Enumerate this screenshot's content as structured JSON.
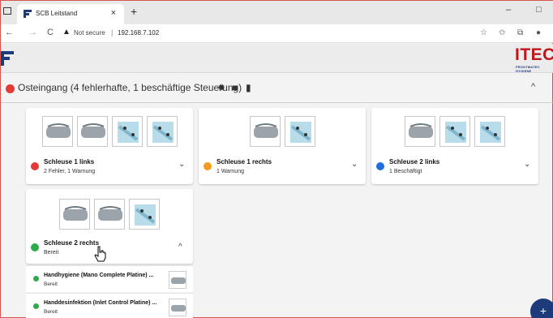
{
  "browser": {
    "tab_title": "SCB Leitstand",
    "tab_close": "×",
    "new_tab": "+",
    "window_minimize": "–",
    "window_maximize": "□",
    "nav_back": "←",
    "nav_forward": "→",
    "nav_reload": "C",
    "security_icon": "warning-triangle-icon",
    "security_label": "Not secure",
    "url_separator": "|",
    "url": "192.168.7.102"
  },
  "app": {
    "brand_main": "ITEC",
    "brand_sub": "FRONTMATEC HYGIENE",
    "colors": {
      "brand_red": "#c0151b",
      "brand_blue": "#1d3a7a",
      "status_red": "#e53935",
      "status_orange": "#f59c1a",
      "status_blue": "#1e6fd9",
      "status_green": "#2eab4b"
    }
  },
  "group": {
    "title": "Osteingang (4 fehlerhafte, 1 beschäftige Steuerung)",
    "status_color": "#e53935",
    "icons": [
      "gear-icon",
      "trash-icon",
      "file-icon"
    ],
    "collapse_glyph": "^"
  },
  "cards": [
    {
      "title": "Schleuse 1 links",
      "status": "2 Fehler, 1 Warnung",
      "status_color": "#e53935",
      "chevron": "⌄",
      "devices": [
        "hand-device",
        "hand-device",
        "sole-device",
        "sole-device"
      ]
    },
    {
      "title": "Schleuse 1 rechts",
      "status": "1 Warnung",
      "status_color": "#f59c1a",
      "chevron": "⌄",
      "devices": [
        "hand-device",
        "sole-device"
      ]
    },
    {
      "title": "Schleuse 2 links",
      "status": "1 Beschäftigt",
      "status_color": "#1e6fd9",
      "chevron": "⌄",
      "devices": [
        "hand-device",
        "sole-device",
        "sole-device"
      ]
    },
    {
      "title": "Schleuse 2 rechts",
      "status": "Bereit",
      "status_color": "#2eab4b",
      "chevron": "^",
      "devices": [
        "hand-device",
        "hand-device",
        "sole-device"
      ]
    }
  ],
  "subitems": [
    {
      "title": "Handhygiene (Mano Complete Platine) ...",
      "status": "Bereit"
    },
    {
      "title": "Handdesinfektion (Inlet Control Platine) ...",
      "status": "Bereit"
    }
  ],
  "fab_label": "+"
}
